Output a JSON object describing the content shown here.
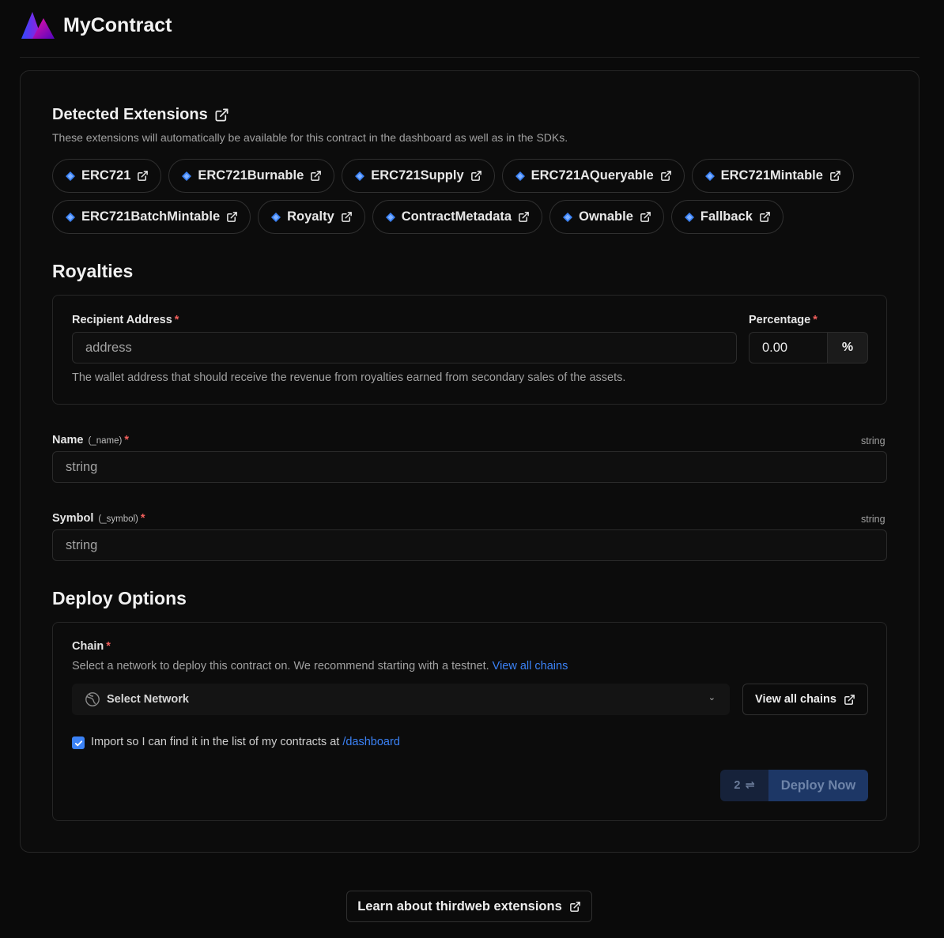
{
  "header": {
    "title": "MyContract"
  },
  "extensions": {
    "title": "Detected Extensions",
    "description": "These extensions will automatically be available for this contract in the dashboard as well as in the SDKs.",
    "items": [
      "ERC721",
      "ERC721Burnable",
      "ERC721Supply",
      "ERC721AQueryable",
      "ERC721Mintable",
      "ERC721BatchMintable",
      "Royalty",
      "ContractMetadata",
      "Ownable",
      "Fallback"
    ]
  },
  "royalties": {
    "title": "Royalties",
    "recipient_label": "Recipient Address",
    "recipient_placeholder": "address",
    "recipient_hint": "The wallet address that should receive the revenue from royalties earned from secondary sales of the assets.",
    "percentage_label": "Percentage",
    "percentage_value": "0.00",
    "percentage_suffix": "%"
  },
  "params": [
    {
      "label": "Name",
      "param": "(_name)",
      "type": "string",
      "placeholder": "string"
    },
    {
      "label": "Symbol",
      "param": "(_symbol)",
      "type": "string",
      "placeholder": "string"
    }
  ],
  "required_mark": "*",
  "deploy": {
    "title": "Deploy Options",
    "chain_label": "Chain",
    "chain_hint": "Select a network to deploy this contract on. We recommend starting with a testnet.",
    "chain_hint_link": "View all chains",
    "select_placeholder": "Select Network",
    "view_chains_button": "View all chains",
    "import_label": "Import so I can find it in the list of my contracts at",
    "import_link": "/dashboard",
    "import_checked": true,
    "tx_count": "2",
    "deploy_button": "Deploy Now"
  },
  "footer": {
    "learn_button": "Learn about thirdweb extensions"
  },
  "colors": {
    "accent": "#3b82f6",
    "required": "#f25f5c",
    "deploy_disabled": "#1d3766"
  },
  "icons": [
    "logo-icon",
    "external-link-icon",
    "diamond-icon",
    "globe-icon",
    "chevron-down-icon",
    "check-icon",
    "swap-icon"
  ]
}
